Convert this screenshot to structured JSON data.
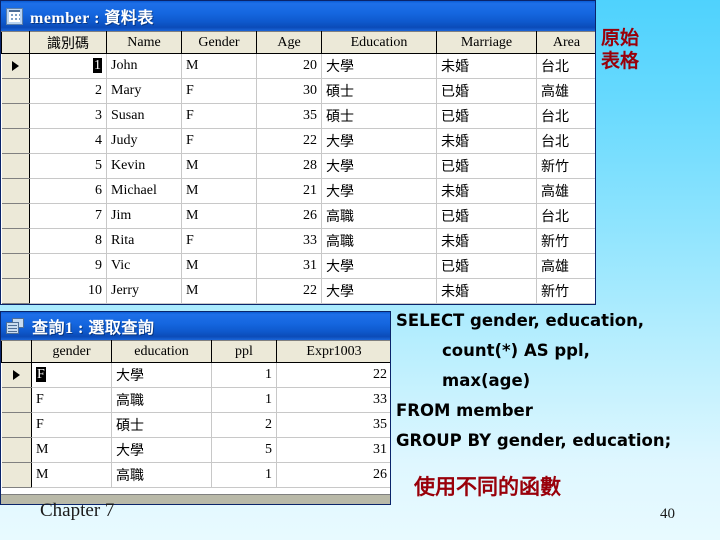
{
  "slide": {
    "chapter_label": "Chapter 7",
    "page_number": "40",
    "background_accent": "#4FD2FD",
    "callout_color": "#99000A"
  },
  "annotations": {
    "original_table": "原始\n表格",
    "different_functions": "使用不同的函數"
  },
  "member_window": {
    "title": "member : 資料表",
    "icon": "datasheet-icon",
    "columns": [
      "識別碼",
      "Name",
      "Gender",
      "Age",
      "Education",
      "Marriage",
      "Area"
    ],
    "rows": [
      {
        "id": "1",
        "name": "John",
        "gender": "M",
        "age": "20",
        "education": "大學",
        "marriage": "未婚",
        "area": "台北",
        "current": true,
        "id_selected": true
      },
      {
        "id": "2",
        "name": "Mary",
        "gender": "F",
        "age": "30",
        "education": "碩士",
        "marriage": "已婚",
        "area": "高雄",
        "current": false,
        "id_selected": false
      },
      {
        "id": "3",
        "name": "Susan",
        "gender": "F",
        "age": "35",
        "education": "碩士",
        "marriage": "已婚",
        "area": "台北",
        "current": false,
        "id_selected": false
      },
      {
        "id": "4",
        "name": "Judy",
        "gender": "F",
        "age": "22",
        "education": "大學",
        "marriage": "未婚",
        "area": "台北",
        "current": false,
        "id_selected": false
      },
      {
        "id": "5",
        "name": "Kevin",
        "gender": "M",
        "age": "28",
        "education": "大學",
        "marriage": "已婚",
        "area": "新竹",
        "current": false,
        "id_selected": false
      },
      {
        "id": "6",
        "name": "Michael",
        "gender": "M",
        "age": "21",
        "education": "大學",
        "marriage": "未婚",
        "area": "高雄",
        "current": false,
        "id_selected": false
      },
      {
        "id": "7",
        "name": "Jim",
        "gender": "M",
        "age": "26",
        "education": "高職",
        "marriage": "已婚",
        "area": "台北",
        "current": false,
        "id_selected": false
      },
      {
        "id": "8",
        "name": "Rita",
        "gender": "F",
        "age": "33",
        "education": "高職",
        "marriage": "未婚",
        "area": "新竹",
        "current": false,
        "id_selected": false
      },
      {
        "id": "9",
        "name": "Vic",
        "gender": "M",
        "age": "31",
        "education": "大學",
        "marriage": "已婚",
        "area": "高雄",
        "current": false,
        "id_selected": false
      },
      {
        "id": "10",
        "name": "Jerry",
        "gender": "M",
        "age": "22",
        "education": "大學",
        "marriage": "未婚",
        "area": "新竹",
        "current": false,
        "id_selected": false
      }
    ]
  },
  "query_window": {
    "title": "查詢1 : 選取查詢",
    "icon": "query-icon",
    "columns": [
      "gender",
      "education",
      "ppl",
      "Expr1003"
    ],
    "rows": [
      {
        "gender": "F",
        "education": "大學",
        "ppl": "1",
        "expr1003": "22",
        "current": true,
        "gender_selected": true
      },
      {
        "gender": "F",
        "education": "高職",
        "ppl": "1",
        "expr1003": "33",
        "current": false,
        "gender_selected": false
      },
      {
        "gender": "F",
        "education": "碩士",
        "ppl": "2",
        "expr1003": "35",
        "current": false,
        "gender_selected": false
      },
      {
        "gender": "M",
        "education": "大學",
        "ppl": "5",
        "expr1003": "31",
        "current": false,
        "gender_selected": false
      },
      {
        "gender": "M",
        "education": "高職",
        "ppl": "1",
        "expr1003": "26",
        "current": false,
        "gender_selected": false
      }
    ]
  },
  "sql": {
    "line1": "SELECT gender, education,",
    "line2": "count(*) AS ppl,",
    "line3": "max(age)",
    "line4": "FROM member",
    "line5": "GROUP BY gender, education;"
  }
}
